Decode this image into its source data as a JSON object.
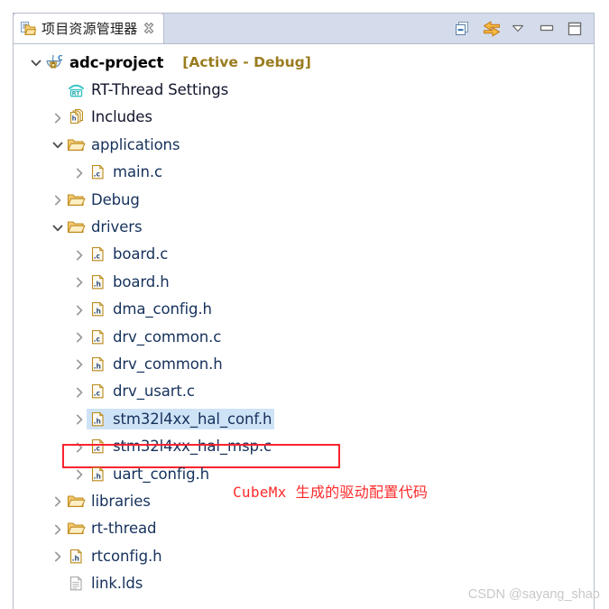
{
  "view": {
    "tab": {
      "title": "项目资源管理器",
      "icon": "project-explorer-icon",
      "close_icon": "close-icon"
    },
    "toolbar": [
      {
        "name": "collapse-all-button",
        "icon": "collapse-all-icon",
        "tooltip": "Collapse All"
      },
      {
        "name": "link-with-editor-button",
        "icon": "link-editor-icon",
        "tooltip": "Link with Editor"
      },
      {
        "name": "view-menu-button",
        "icon": "chevron-down-icon",
        "tooltip": "View Menu"
      },
      {
        "name": "minimize-button",
        "icon": "minimize-icon",
        "tooltip": "Minimize"
      },
      {
        "name": "maximize-button",
        "icon": "maximize-icon",
        "tooltip": "Maximize"
      }
    ]
  },
  "tree": {
    "rows": [
      {
        "name": "tree-item-adc-project",
        "label": "adc-project",
        "suffix": "[Active - Debug]",
        "icon": "c-project-icon",
        "indent": 0,
        "twisty": "expanded",
        "style": "bold"
      },
      {
        "name": "tree-item-rt-thread-settings",
        "label": "RT-Thread Settings",
        "suffix": "",
        "icon": "rt-thread-icon",
        "indent": 1,
        "twisty": "none",
        "style": "dark"
      },
      {
        "name": "tree-item-includes",
        "label": "Includes",
        "suffix": "",
        "icon": "includes-icon",
        "indent": 1,
        "twisty": "collapsed",
        "style": "dark"
      },
      {
        "name": "tree-item-applications",
        "label": "applications",
        "suffix": "",
        "icon": "folder-icon",
        "indent": 1,
        "twisty": "expanded",
        "style": "normal"
      },
      {
        "name": "tree-item-main-c",
        "label": "main.c",
        "suffix": "",
        "icon": "c-file-icon",
        "indent": 2,
        "twisty": "collapsed",
        "style": "normal"
      },
      {
        "name": "tree-item-debug",
        "label": "Debug",
        "suffix": "",
        "icon": "folder-icon",
        "indent": 1,
        "twisty": "collapsed",
        "style": "normal"
      },
      {
        "name": "tree-item-drivers",
        "label": "drivers",
        "suffix": "",
        "icon": "folder-icon",
        "indent": 1,
        "twisty": "expanded",
        "style": "normal"
      },
      {
        "name": "tree-item-board-c",
        "label": "board.c",
        "suffix": "",
        "icon": "c-file-icon",
        "indent": 2,
        "twisty": "collapsed",
        "style": "normal"
      },
      {
        "name": "tree-item-board-h",
        "label": "board.h",
        "suffix": "",
        "icon": "h-file-icon",
        "indent": 2,
        "twisty": "collapsed",
        "style": "normal"
      },
      {
        "name": "tree-item-dma-config-h",
        "label": "dma_config.h",
        "suffix": "",
        "icon": "h-file-icon",
        "indent": 2,
        "twisty": "collapsed",
        "style": "normal"
      },
      {
        "name": "tree-item-drv-common-c",
        "label": "drv_common.c",
        "suffix": "",
        "icon": "c-file-icon",
        "indent": 2,
        "twisty": "collapsed",
        "style": "normal"
      },
      {
        "name": "tree-item-drv-common-h",
        "label": "drv_common.h",
        "suffix": "",
        "icon": "h-file-icon",
        "indent": 2,
        "twisty": "collapsed",
        "style": "normal"
      },
      {
        "name": "tree-item-drv-usart-c",
        "label": "drv_usart.c",
        "suffix": "",
        "icon": "c-file-icon",
        "indent": 2,
        "twisty": "collapsed",
        "style": "normal"
      },
      {
        "name": "tree-item-stm32l4xx-hal-conf-h",
        "label": "stm32l4xx_hal_conf.h",
        "suffix": "",
        "icon": "h-file-icon",
        "indent": 2,
        "twisty": "collapsed",
        "style": "normal",
        "selected": true
      },
      {
        "name": "tree-item-stm32l4xx-hal-msp-c",
        "label": "stm32l4xx_hal_msp.c",
        "suffix": "",
        "icon": "c-file-icon",
        "indent": 2,
        "twisty": "collapsed",
        "style": "normal",
        "boxed": true
      },
      {
        "name": "tree-item-uart-config-h",
        "label": "uart_config.h",
        "suffix": "",
        "icon": "h-file-icon",
        "indent": 2,
        "twisty": "collapsed",
        "style": "normal"
      },
      {
        "name": "tree-item-libraries",
        "label": "libraries",
        "suffix": "",
        "icon": "folder-icon",
        "indent": 1,
        "twisty": "collapsed",
        "style": "normal"
      },
      {
        "name": "tree-item-rt-thread",
        "label": "rt-thread",
        "suffix": "",
        "icon": "folder-icon",
        "indent": 1,
        "twisty": "collapsed",
        "style": "normal"
      },
      {
        "name": "tree-item-rtconfig-h",
        "label": "rtconfig.h",
        "suffix": "",
        "icon": "h-file-icon",
        "indent": 1,
        "twisty": "collapsed",
        "style": "normal"
      },
      {
        "name": "tree-item-link-lds",
        "label": "link.lds",
        "suffix": "",
        "icon": "generic-file-icon",
        "indent": 1,
        "twisty": "none",
        "style": "normal"
      }
    ]
  },
  "annotation": {
    "text": "CubeMx 生成的驱动配置代码",
    "color": "#fd2a2a"
  },
  "watermark": {
    "text": "CSDN @sayang_shao"
  },
  "colors": {
    "tab_strip": "#d4dcec",
    "selection": "#cfe3f7",
    "annotation_red": "#f8242f",
    "label_blue": "#16325c",
    "active_config": "#9a7c20"
  }
}
